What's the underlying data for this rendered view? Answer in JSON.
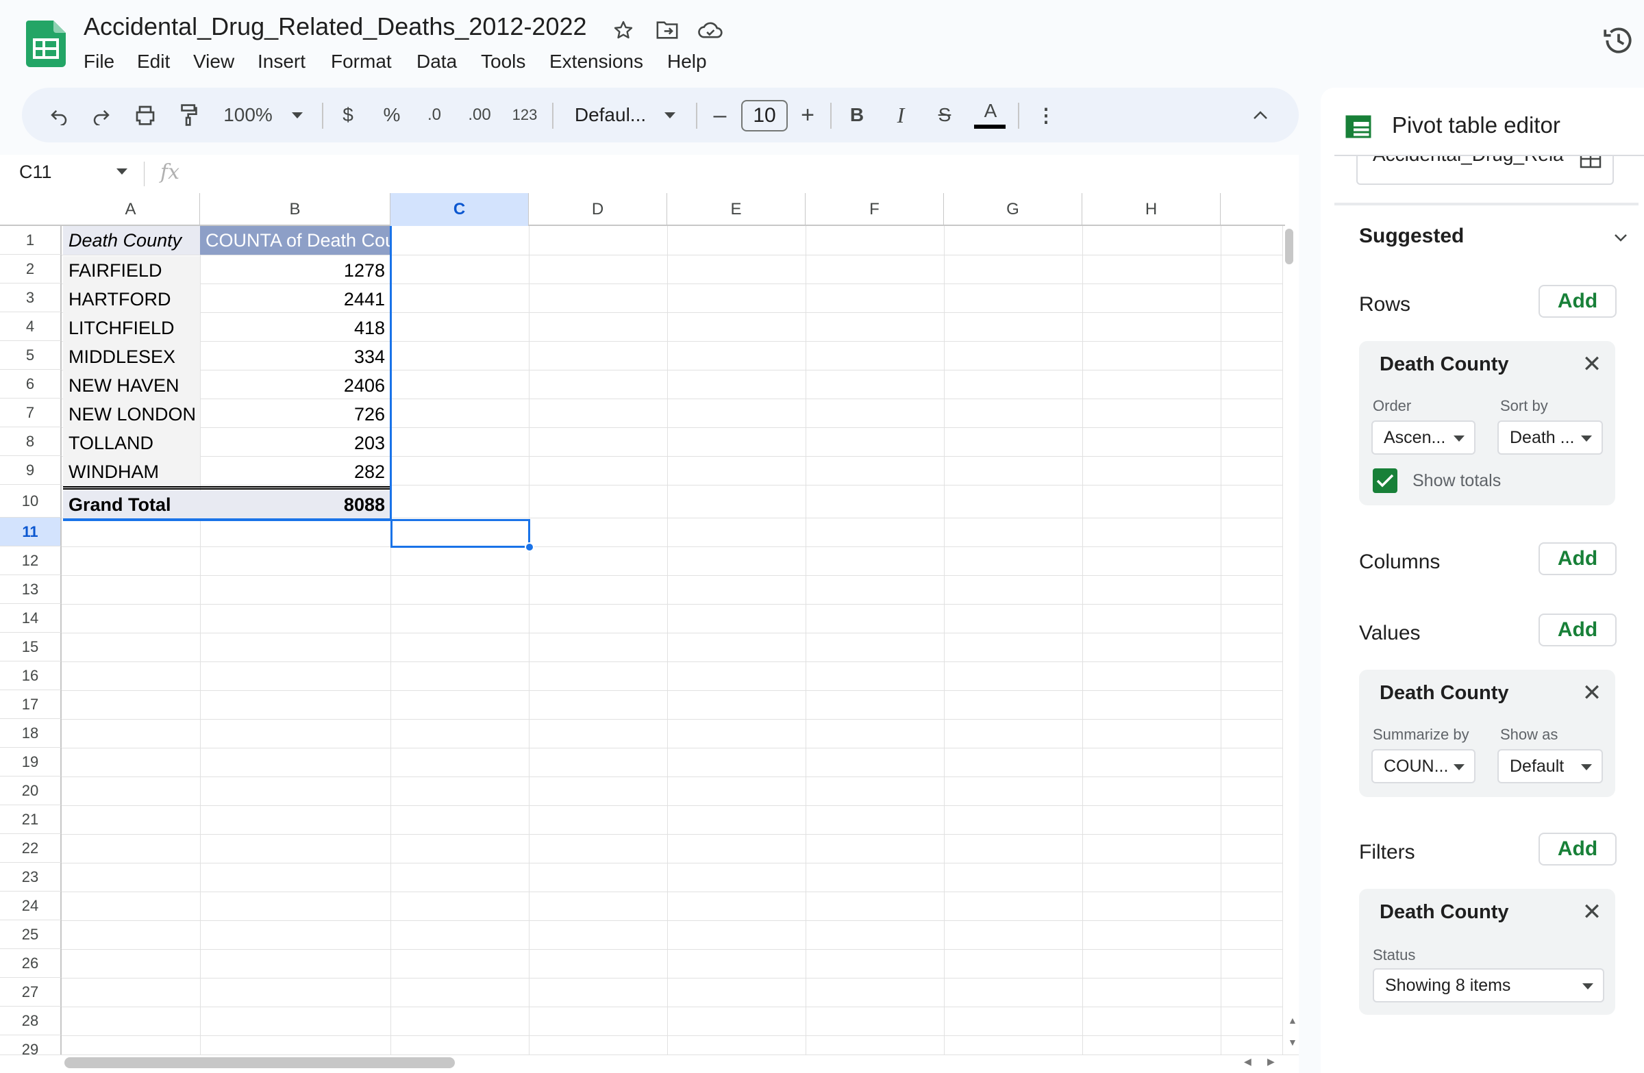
{
  "app": {
    "doc_title": "Accidental_Drug_Related_Deaths_2012-2022",
    "menu": [
      "File",
      "Edit",
      "View",
      "Insert",
      "Format",
      "Data",
      "Tools",
      "Extensions",
      "Help"
    ]
  },
  "toolbar": {
    "zoom": "100%",
    "currency": "$",
    "percent": "%",
    "dec_decrease": ".0",
    "dec_increase": ".00",
    "number_format": "123",
    "font": "Defaul...",
    "font_size": "10",
    "minus": "–",
    "plus": "+",
    "bold": "B",
    "italic": "I",
    "strike": "S",
    "text_color": "A",
    "more": "⋮"
  },
  "formula_bar": {
    "name_box": "C11",
    "fx": "fx"
  },
  "grid": {
    "columns": [
      "A",
      "B",
      "C",
      "D",
      "E",
      "F",
      "G",
      "H"
    ],
    "rows": [
      "1",
      "2",
      "3",
      "4",
      "5",
      "6",
      "7",
      "8",
      "9",
      "10",
      "11",
      "12",
      "13",
      "14",
      "15",
      "16",
      "17",
      "18",
      "19",
      "20",
      "21",
      "22",
      "23",
      "24",
      "25",
      "26",
      "27",
      "28",
      "29"
    ],
    "selected_col": "C",
    "selected_row": "11",
    "pivot": {
      "header_a": "Death County",
      "header_b": "COUNTA of Death County",
      "rows": [
        {
          "county": "FAIRFIELD",
          "count": "1278"
        },
        {
          "county": "HARTFORD",
          "count": "2441"
        },
        {
          "county": "LITCHFIELD",
          "count": "418"
        },
        {
          "county": "MIDDLESEX",
          "count": "334"
        },
        {
          "county": "NEW HAVEN",
          "count": "2406"
        },
        {
          "county": "NEW LONDON",
          "count": "726"
        },
        {
          "county": "TOLLAND",
          "count": "203"
        },
        {
          "county": "WINDHAM",
          "count": "282"
        }
      ],
      "total_label": "Grand Total",
      "total_value": "8088"
    }
  },
  "panel": {
    "title": "Pivot table editor",
    "range": "Accidental_Drug_Rela",
    "suggested": "Suggested",
    "rows_label": "Rows",
    "columns_label": "Columns",
    "values_label": "Values",
    "filters_label": "Filters",
    "add": "Add",
    "rows_card": {
      "title": "Death County",
      "order_label": "Order",
      "order_value": "Ascen...",
      "sort_label": "Sort by",
      "sort_value": "Death ...",
      "show_totals": "Show totals"
    },
    "values_card": {
      "title": "Death County",
      "summarize_label": "Summarize by",
      "summarize_value": "COUN...",
      "show_as_label": "Show as",
      "show_as_value": "Default"
    },
    "filters_card": {
      "title": "Death County",
      "status_label": "Status",
      "status_value": "Showing 8 items"
    }
  },
  "colors": {
    "accent_blue": "#1a73e8",
    "green": "#188038",
    "pivot_header": "#8d9fc7",
    "selection": "#d3e3fd"
  }
}
